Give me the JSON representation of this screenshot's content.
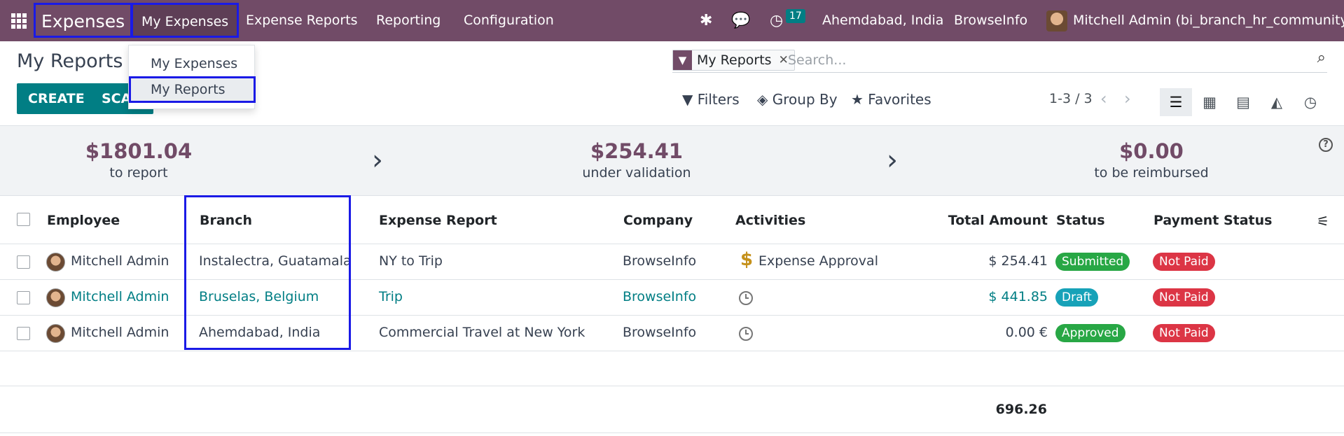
{
  "navbar": {
    "app_name": "Expenses",
    "menu": [
      "My Expenses",
      "Expense Reports",
      "Reporting",
      "Configuration"
    ],
    "activity_count": "17",
    "branch": "Ahemdabad, India",
    "company": "BrowseInfo",
    "user": "Mitchell Admin (bi_branch_hr_community)",
    "colors": {
      "primary": "#714b67",
      "highlight_box": "#1a1ae6"
    }
  },
  "dropdown": {
    "items": [
      "My Expenses",
      "My Reports"
    ],
    "active": "My Reports"
  },
  "control_panel": {
    "title": "My Reports",
    "create_label": "CREATE",
    "scan_label": "SCAN",
    "facet": "My Reports",
    "search_placeholder": "Search...",
    "filters_label": "Filters",
    "group_by_label": "Group By",
    "favorites_label": "Favorites",
    "pager": "1-3 / 3",
    "views": [
      "list",
      "kanban",
      "pivot",
      "graph",
      "activity"
    ],
    "active_view": "list"
  },
  "summary": [
    {
      "amount": "$1801.04",
      "label": "to report"
    },
    {
      "amount": "$254.41",
      "label": "under validation"
    },
    {
      "amount": "$0.00",
      "label": "to be reimbursed"
    }
  ],
  "table": {
    "headers": {
      "employee": "Employee",
      "branch": "Branch",
      "report": "Expense Report",
      "company": "Company",
      "activities": "Activities",
      "total": "Total Amount",
      "status": "Status",
      "payment": "Payment Status"
    },
    "rows": [
      {
        "employee": "Mitchell Admin",
        "branch": "Instalectra, Guatamala",
        "report": "NY to Trip",
        "company": "BrowseInfo",
        "activity": "Expense Approval",
        "total": "$ 254.41",
        "status": "Submitted",
        "payment": "Not Paid"
      },
      {
        "employee": "Mitchell Admin",
        "branch": "Bruselas, Belgium",
        "report": "Trip",
        "company": "BrowseInfo",
        "activity": "",
        "total": "$ 441.85",
        "status": "Draft",
        "payment": "Not Paid"
      },
      {
        "employee": "Mitchell Admin",
        "branch": "Ahemdabad, India",
        "report": "Commercial Travel at New York",
        "company": "BrowseInfo",
        "activity": "",
        "total": "0.00 €",
        "status": "Approved",
        "payment": "Not Paid"
      }
    ],
    "grand_total": "696.26",
    "status_colors": {
      "Submitted": "#28a745",
      "Draft": "#17a2b8",
      "Approved": "#28a745",
      "Not Paid": "#dc3545"
    }
  }
}
